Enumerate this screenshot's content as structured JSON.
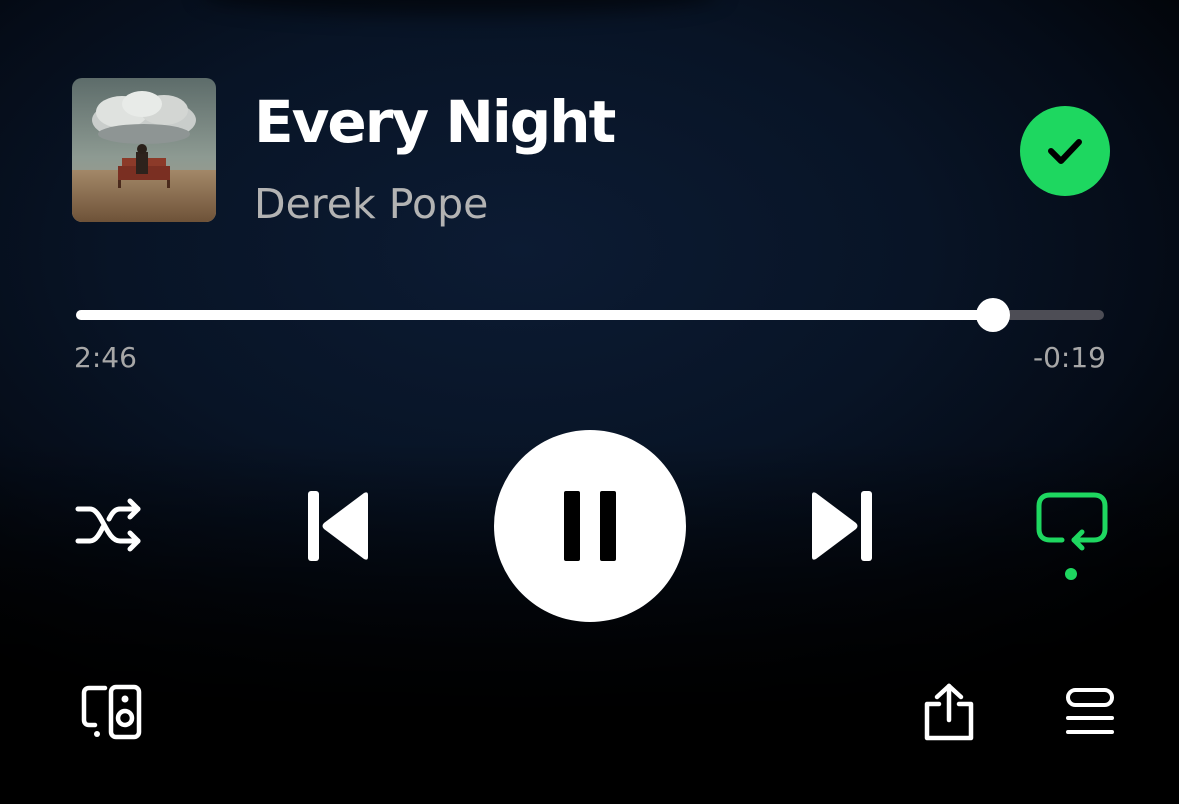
{
  "track": {
    "title": "Every Night",
    "artist": "Derek Pope",
    "saved": true
  },
  "progress": {
    "elapsed": "2:46",
    "remaining": "-0:19",
    "fraction": 0.8925
  },
  "controls": {
    "shuffle_icon": "shuffle-icon",
    "previous_icon": "skip-previous-icon",
    "play_state_icon": "pause-icon",
    "next_icon": "skip-next-icon",
    "repeat_icon": "repeat-icon",
    "repeat_active": true
  },
  "bottom_bar": {
    "devices_icon": "connect-devices-icon",
    "share_icon": "share-icon",
    "queue_icon": "queue-icon"
  },
  "colors": {
    "accent": "#1ed760",
    "secondary_text": "#b3b3b3",
    "progress_remaining": "#4d4d55"
  }
}
